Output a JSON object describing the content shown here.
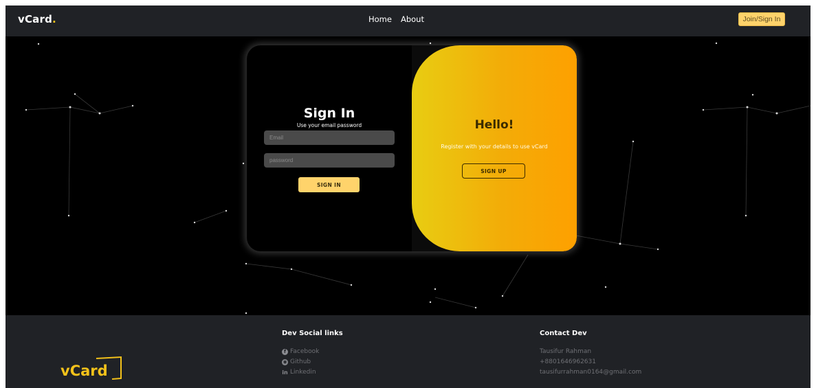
{
  "navbar": {
    "logo_text": "vCard",
    "logo_dot": ".",
    "links": [
      "Home",
      "About"
    ],
    "join_label": "Join/Sign In"
  },
  "signin": {
    "title": "Sign In",
    "subtitle": "Use your email password",
    "email_placeholder": "Email",
    "password_placeholder": "password",
    "button_label": "SIGN IN"
  },
  "register": {
    "title": "Hello!",
    "text": "Register with your details to use vCard",
    "button_label": "SIGN UP"
  },
  "footer": {
    "logo_text": "vCard",
    "social": {
      "title": "Dev Social links",
      "items": [
        {
          "icon": "facebook-icon",
          "label": "Facebook"
        },
        {
          "icon": "github-icon",
          "label": "Github"
        },
        {
          "icon": "linkedin-icon",
          "label": "Linkedin"
        }
      ]
    },
    "contact": {
      "title": "Contact Dev",
      "name": "Tausifur Rahman",
      "phone": "+8801646962631",
      "email": "tausifurrahman0164@gmail.com"
    }
  },
  "colors": {
    "accent": "#ffd36b",
    "brand_yellow": "#f4c21a",
    "navbar_bg": "#202226",
    "panel_gradient_start": "#e8cd12",
    "panel_gradient_end": "#fea000"
  }
}
